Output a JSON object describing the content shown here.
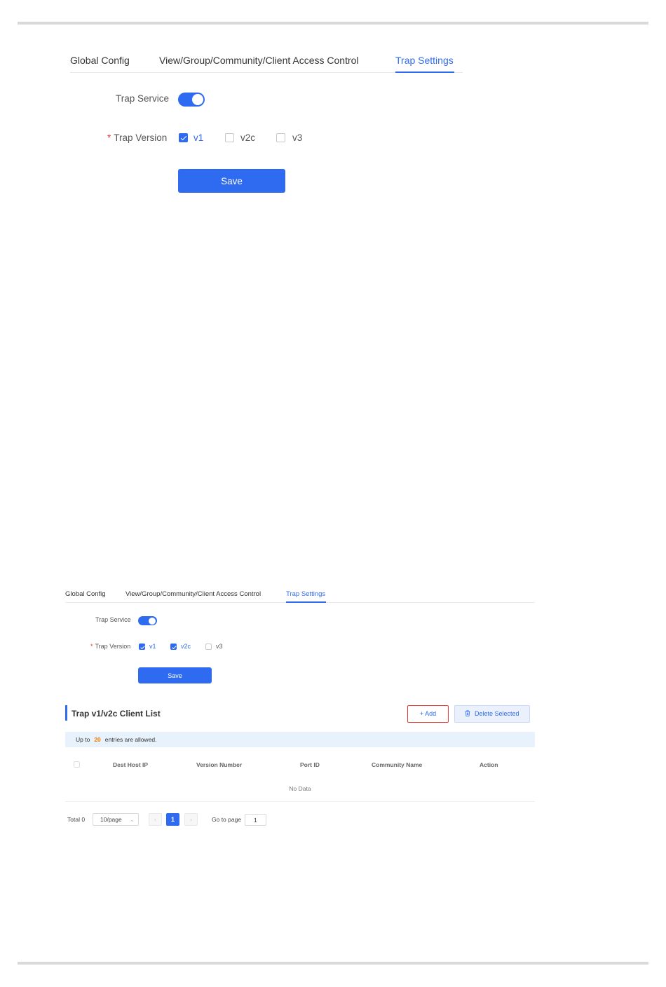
{
  "upper": {
    "tabs": [
      "Global Config",
      "View/Group/Community/Client Access Control",
      "Trap Settings"
    ],
    "active_tab": "Trap Settings",
    "trap_service_label": "Trap Service",
    "trap_service_on": true,
    "trap_version_label": "Trap Version",
    "required_mark": "*",
    "versions": [
      {
        "label": "v1",
        "checked": true
      },
      {
        "label": "v2c",
        "checked": false
      },
      {
        "label": "v3",
        "checked": false
      }
    ],
    "save_label": "Save"
  },
  "lower": {
    "tabs": [
      "Global Config",
      "View/Group/Community/Client Access Control",
      "Trap Settings"
    ],
    "active_tab": "Trap Settings",
    "trap_service_label": "Trap Service",
    "trap_service_on": true,
    "trap_version_label": "Trap Version",
    "required_mark": "*",
    "versions": [
      {
        "label": "v1",
        "checked": true
      },
      {
        "label": "v2c",
        "checked": true
      },
      {
        "label": "v3",
        "checked": false
      }
    ],
    "save_label": "Save",
    "list_title": "Trap v1/v2c Client List",
    "add_label": "+ Add",
    "delete_label": "Delete Selected",
    "delete_icon": "trash-icon",
    "notice_prefix": "Up to",
    "notice_count": "20",
    "notice_suffix": "entries are allowed.",
    "columns": [
      "Dest Host IP",
      "Version Number",
      "Port ID",
      "Community Name",
      "Action"
    ],
    "empty_text": "No Data",
    "pagination": {
      "total_label": "Total 0",
      "page_size": "10/page",
      "prev": "‹",
      "current_page": "1",
      "next": "›",
      "goto_label": "Go to page",
      "goto_value": "1"
    }
  },
  "colors": {
    "accent": "#2e6bf0",
    "required": "#e53935",
    "highlight_border": "#e53935",
    "count_highlight": "#f57c00",
    "notice_bg": "#e8f2fd"
  }
}
